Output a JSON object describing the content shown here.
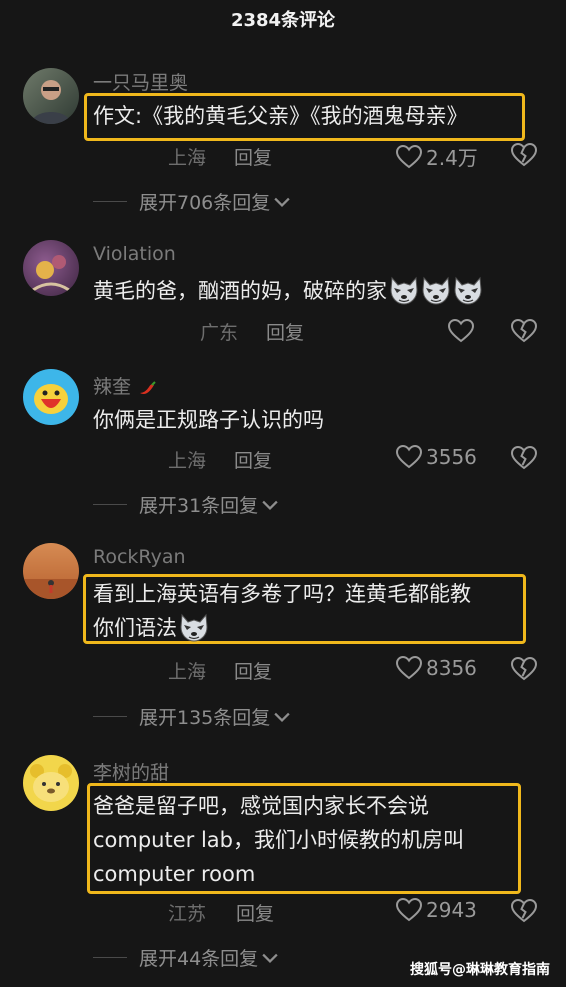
{
  "header": {
    "title": "2384条评论"
  },
  "comments": [
    {
      "user": "一只马里奥",
      "text": "作文:《我的黄毛父亲》《我的酒鬼母亲》",
      "location": "上海",
      "reply": "回复",
      "likes": "2.4万",
      "expand": "展开706条回复"
    },
    {
      "user": "Violation",
      "text": "黄毛的爸，酗酒的妈，破碎的家",
      "location": "广东",
      "reply": "回复",
      "likes": "",
      "expand": ""
    },
    {
      "user": "辣奎",
      "text": "你俩是正规路子认识的吗",
      "location": "上海",
      "reply": "回复",
      "likes": "3556",
      "expand": "展开31条回复"
    },
    {
      "user": "RockRyan",
      "text_line1": "看到上海英语有多卷了吗？连黄毛都能教",
      "text_line2": "你们语法",
      "location": "上海",
      "reply": "回复",
      "likes": "8356",
      "expand": "展开135条回复"
    },
    {
      "user": "李树的甜",
      "text_line1": "爸爸是留子吧，感觉国内家长不会说",
      "text_line2": "computer lab，我们小时候教的机房叫",
      "text_line3": "computer room",
      "location": "江苏",
      "reply": "回复",
      "likes": "2943",
      "expand": "展开44条回复"
    }
  ],
  "watermark": "搜狐号@琳琳教育指南",
  "colors": {
    "highlight": "#f0b81c",
    "background": "#161616"
  },
  "icons": [
    "heart-icon",
    "broken-heart-icon",
    "chevron-down-icon",
    "wolf-emoji",
    "chili-emoji"
  ]
}
